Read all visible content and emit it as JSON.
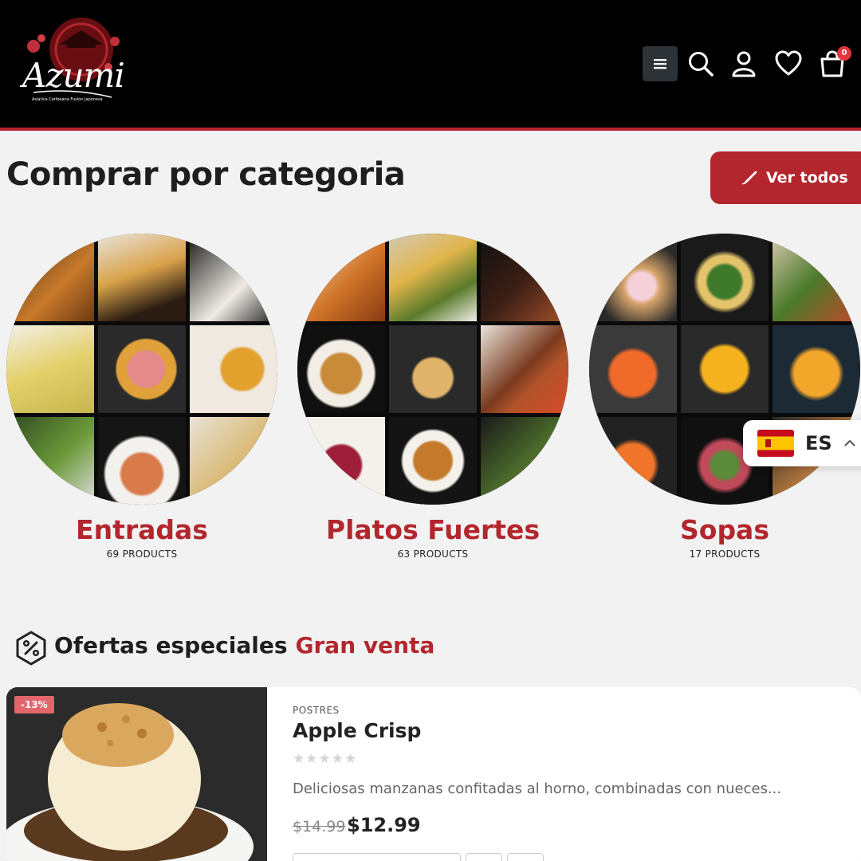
{
  "header": {
    "logo_text": "Azumi",
    "logo_subtitle": "Asiatica Caribeana Fusión Japonesa",
    "cart_count": "0",
    "icons": [
      "menu-icon",
      "search-icon",
      "user-icon",
      "heart-icon",
      "shopping-bag-icon"
    ]
  },
  "categories_section": {
    "title": "Comprar por categoria",
    "view_all_label": "Ver todos",
    "items": [
      {
        "name": "Entradas",
        "count": "69 PRODUCTS"
      },
      {
        "name": "Platos Fuertes",
        "count": "63 PRODUCTS"
      },
      {
        "name": "Sopas",
        "count": "17 PRODUCTS"
      }
    ]
  },
  "language": {
    "code": "ES",
    "flag": "spain-flag-icon"
  },
  "offers": {
    "title": "Ofertas especiales",
    "highlight": "Gran venta",
    "product": {
      "discount": "-13%",
      "category": "POSTRES",
      "name": "Apple Crisp",
      "rating_stars": "★★★★★",
      "description": "Deliciosas manzanas confitadas al horno, combinadas con nueces...",
      "old_price": "$14.99",
      "price": "$12.99"
    }
  },
  "colors": {
    "brand_red": "#b3262d",
    "header_bg": "#000000",
    "page_bg": "#f2f2f2"
  }
}
